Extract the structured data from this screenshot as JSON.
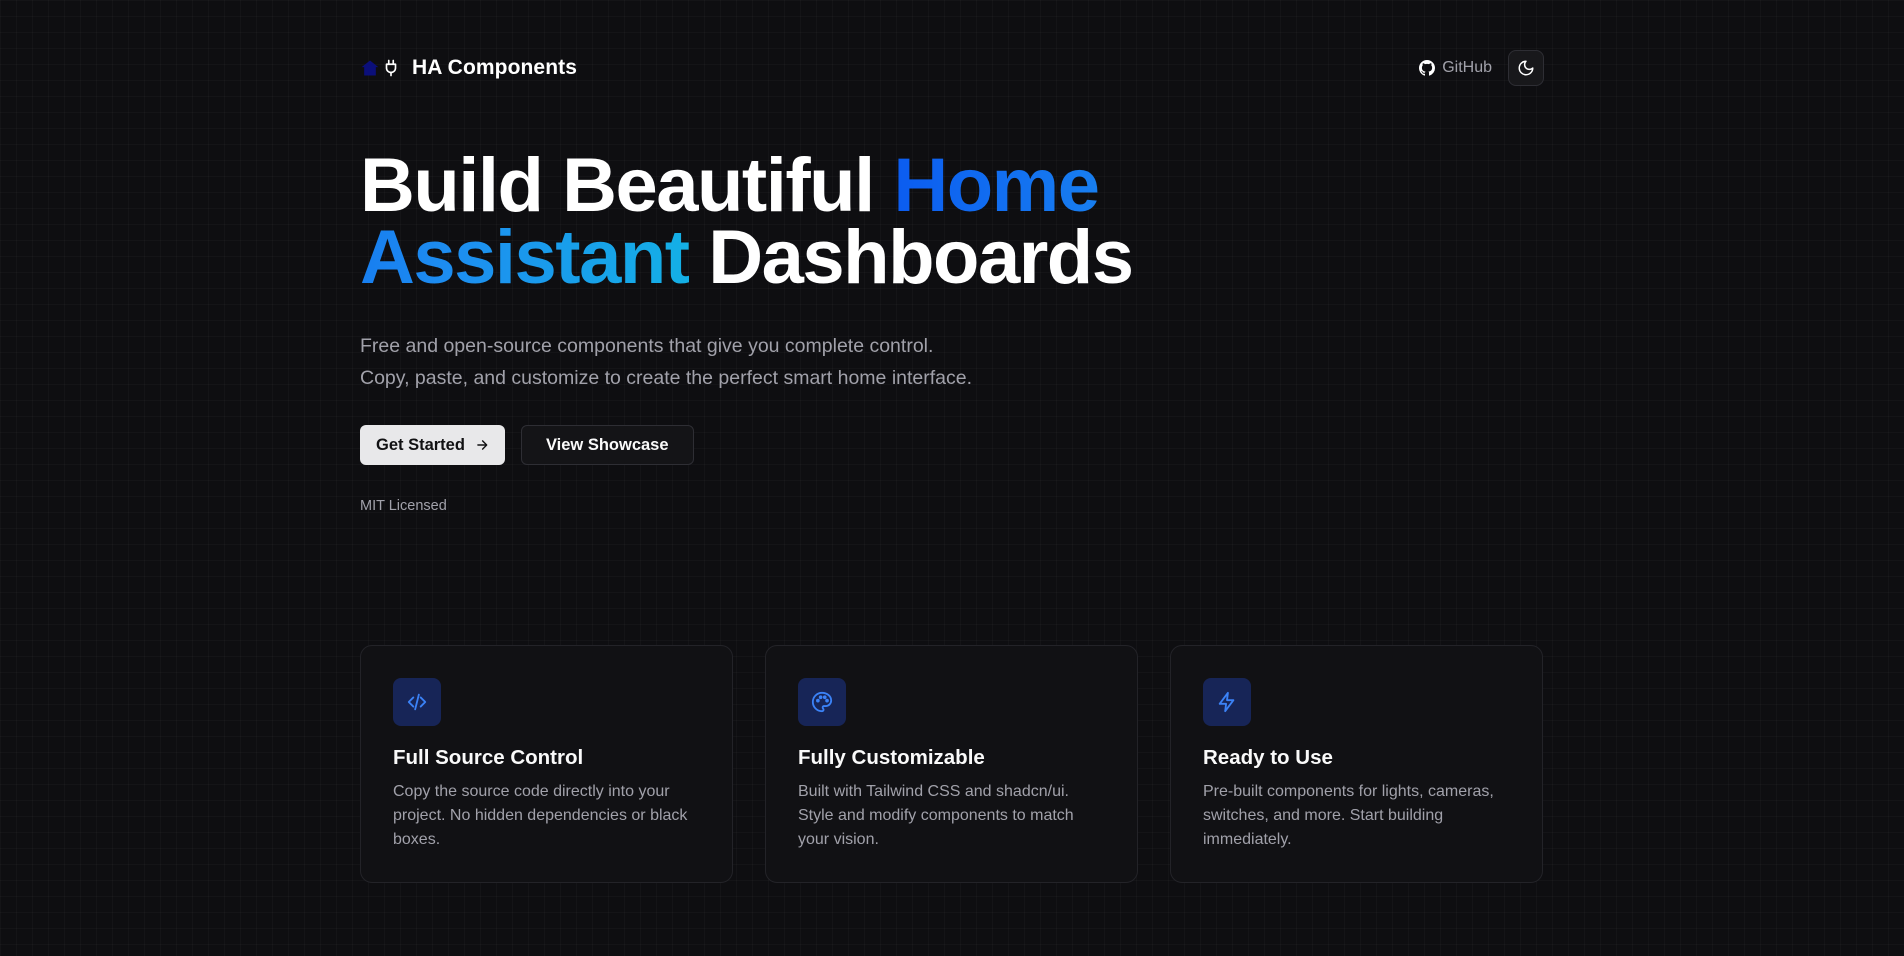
{
  "header": {
    "brand_title": "HA Components",
    "brand_icons": [
      "home-icon",
      "plug-icon"
    ],
    "github_label": "GitHub",
    "github_icon": "github-icon",
    "theme_icon": "moon-icon"
  },
  "hero": {
    "title_part1": "Build Beautiful",
    "title_accent": "Home Assistant",
    "title_part2": "Dashboards",
    "subtitle_line1": "Free and open-source components that give you complete control.",
    "subtitle_line2": "Copy, paste, and customize to create the perfect smart home interface.",
    "primary_button": "Get Started",
    "secondary_button": "View Showcase",
    "license": "MIT Licensed"
  },
  "features": [
    {
      "icon": "code-icon",
      "title": "Full Source Control",
      "description": "Copy the source code directly into your project. No hidden dependencies or black boxes."
    },
    {
      "icon": "palette-icon",
      "title": "Fully Customizable",
      "description": "Built with Tailwind CSS and shadcn/ui. Style and modify components to match your vision."
    },
    {
      "icon": "zap-icon",
      "title": "Ready to Use",
      "description": "Pre-built components for lights, cameras, switches, and more. Start building immediately."
    }
  ],
  "colors": {
    "background": "#0e0e11",
    "accent_start": "#0b5cf0",
    "accent_end": "#14b0e6",
    "icon_tile": "#172557",
    "icon_stroke": "#3b82f6"
  }
}
